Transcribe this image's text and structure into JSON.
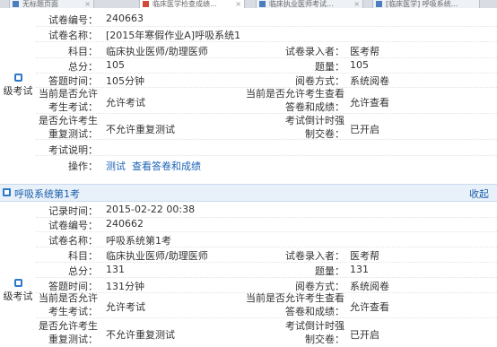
{
  "tabs": [
    {
      "label": "无标题页面"
    },
    {
      "label": "临床医学检查成绩..."
    },
    {
      "label": "临床执业医师考试..."
    },
    {
      "label": "[临床医学] 呼吸系统..."
    }
  ],
  "exam1": {
    "left_label": "级考试",
    "fields": {
      "exam_no_label": "试卷编号：",
      "exam_no": "240663",
      "exam_name_label": "试卷名称：",
      "exam_name": "[2015年寒假作业A]呼吸系统1",
      "subject_label": "科目：",
      "subject": "临床执业医师/助理医师",
      "entered_by_label": "试卷录入者：",
      "entered_by": "医考帮",
      "total_label": "总分：",
      "total": "105",
      "qcount_label": "题量：",
      "qcount": "105",
      "time_label": "答题时间：",
      "time": "105分钟",
      "grading_label": "阅卷方式：",
      "grading": "系统阅卷",
      "allow_exam_label": "当前是否允许考生考试：",
      "allow_exam": "允许考试",
      "allow_view_label": "当前是否允许考生查看答卷和成绩：",
      "allow_view": "允许查看",
      "allow_retest_label": "是否允许考生重复测试：",
      "allow_retest": "不允许重复测试",
      "countdown_label": "考试倒计时强制交卷：",
      "countdown": "已开启",
      "desc_label": "考试说明：",
      "desc": "",
      "ops_label": "操作：",
      "op_test": "测试",
      "op_view": "查看答卷和成绩"
    }
  },
  "bar": {
    "title": "呼吸系统第1考",
    "collapse": "收起"
  },
  "exam2": {
    "left_label": "级考试",
    "fields": {
      "record_time_label": "记录时间：",
      "record_time": "2015-02-22 00:38",
      "exam_no_label": "试卷编号：",
      "exam_no": "240662",
      "exam_name_label": "试卷名称：",
      "exam_name": "呼吸系统第1考",
      "subject_label": "科目：",
      "subject": "临床执业医师/助理医师",
      "entered_by_label": "试卷录入者：",
      "entered_by": "医考帮",
      "total_label": "总分：",
      "total": "131",
      "qcount_label": "题量：",
      "qcount": "131",
      "time_label": "答题时间：",
      "time": "131分钟",
      "grading_label": "阅卷方式：",
      "grading": "系统阅卷",
      "allow_exam_label": "当前是否允许考生考试：",
      "allow_exam": "允许考试",
      "allow_view_label": "当前是否允许考生查看答卷和成绩：",
      "allow_view": "允许查看",
      "allow_retest_label": "是否允许考生重复测试：",
      "allow_retest": "不允许重复测试",
      "countdown_label": "考试倒计时强制交卷：",
      "countdown": "已开启"
    }
  }
}
